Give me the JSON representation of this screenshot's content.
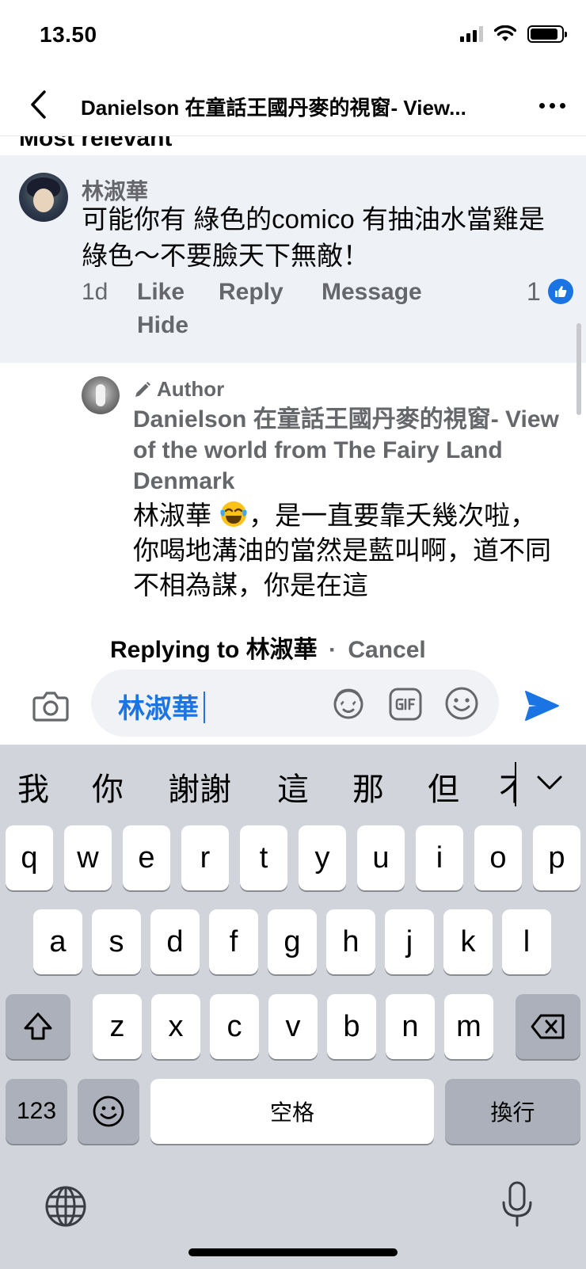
{
  "status_bar": {
    "time": "13.50"
  },
  "nav": {
    "title": "Danielson 在童話王國丹麥的視窗- View..."
  },
  "comments": {
    "section_label": "Most relevant",
    "comment": {
      "author": "林淑華",
      "text": "可能你有 綠色的comico 有抽油水當雞是綠色～不要臉天下無敵！",
      "time": "1d",
      "like_label": "Like",
      "reply_label": "Reply",
      "message_label": "Message",
      "hide_label": "Hide",
      "reaction_count": "1"
    },
    "reply": {
      "badge": "Author",
      "author": "Danielson 在童話王國丹麥的視窗- View of the world from The Fairy Land Denmark",
      "mention": "林淑華",
      "text": "，是一直要靠夭幾次啦，你喝地溝油的當然是藍叫啊，道不同不相為謀，你是在這"
    }
  },
  "composer": {
    "replying_prefix": "Replying to",
    "replying_name": "林淑華",
    "separator": "·",
    "cancel_label": "Cancel",
    "input_value": "林淑華"
  },
  "keyboard": {
    "suggestions": [
      "我",
      "你",
      "謝謝",
      "這",
      "那",
      "但",
      "不"
    ],
    "row1": [
      "q",
      "w",
      "e",
      "r",
      "t",
      "y",
      "u",
      "i",
      "o",
      "p"
    ],
    "row2": [
      "a",
      "s",
      "d",
      "f",
      "g",
      "h",
      "j",
      "k",
      "l"
    ],
    "row3": [
      "z",
      "x",
      "c",
      "v",
      "b",
      "n",
      "m"
    ],
    "numbers_label": "123",
    "space_label": "空格",
    "return_label": "換行"
  },
  "colors": {
    "accent": "#1b74e4",
    "secondary_text": "#65676b",
    "highlight_bg": "#eef1f6",
    "keyboard_bg": "#d1d4db"
  },
  "icons": {
    "back": "chevron-left-icon",
    "more": "more-dots-icon",
    "camera": "camera-icon",
    "send": "send-icon",
    "gif": "gif-icon",
    "emoji": "emoji-icon",
    "avatar_sticker": "avatar-sticker-icon",
    "like_reaction": "thumbs-up-icon",
    "globe": "globe-icon",
    "mic": "microphone-icon",
    "shift": "shift-icon",
    "delete": "delete-icon"
  }
}
